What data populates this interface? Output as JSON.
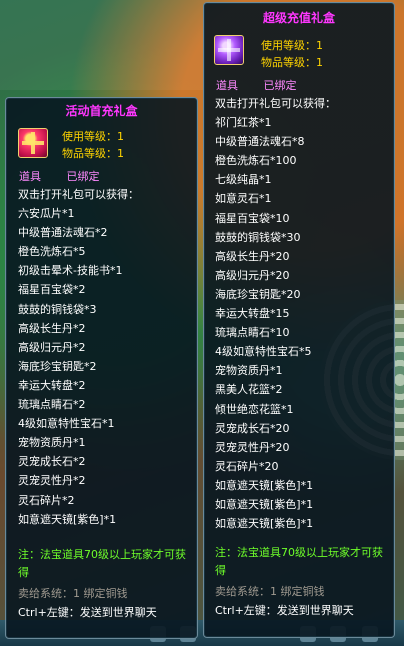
{
  "colors": {
    "title": "#ff37ff",
    "meta": "#ffd400",
    "tag": "#ff8aff",
    "note": "#6fff2a",
    "system": "#a09a90",
    "text": "#ffffff"
  },
  "tooltip_left": {
    "title": "活动首充礼盒",
    "icon": "red-gift-box-icon",
    "use_level": "使用等级：1",
    "item_level": "物品等级：1",
    "tag_type": "道具",
    "tag_bind": "已绑定",
    "desc": "双击打开礼包可以获得：",
    "items": [
      "六安瓜片*1",
      "中级普通法魂石*2",
      "橙色洗炼石*5",
      "初级击晕术-技能书*1",
      "福星百宝袋*2",
      "鼓鼓的铜钱袋*3",
      "高级长生丹*2",
      "高级归元丹*2",
      "海底珍宝钥匙*2",
      "幸运大转盘*2",
      "琉璃点睛石*2",
      "4级如意特性宝石*1",
      "宠物资质丹*1",
      "灵宠成长石*2",
      "灵宠灵性丹*2",
      "灵石碎片*2",
      "如意遮天镜[紫色]*1"
    ],
    "note": "注：法宝道具70级以上玩家才可获得",
    "system": "卖给系统：1 绑定铜钱",
    "ctrl": "Ctrl+左键：发送到世界聊天"
  },
  "tooltip_right": {
    "title": "超级充值礼盒",
    "icon": "purple-gift-box-icon",
    "use_level": "使用等级：1",
    "item_level": "物品等级：1",
    "tag_type": "道具",
    "tag_bind": "已绑定",
    "desc": "双击打开礼包可以获得：",
    "items": [
      "祁门红茶*1",
      "中级普通法魂石*8",
      "橙色洗炼石*100",
      "七级纯晶*1",
      "如意灵石*1",
      "福星百宝袋*10",
      "鼓鼓的铜钱袋*30",
      "高级长生丹*20",
      "高级归元丹*20",
      "海底珍宝钥匙*20",
      "幸运大转盘*15",
      "琉璃点睛石*10",
      "4级如意特性宝石*5",
      "宠物资质丹*1",
      "黑美人花篮*2",
      "倾世绝恋花篮*1",
      "灵宠成长石*20",
      "灵宠灵性丹*20",
      "灵石碎片*20",
      "如意遮天镜[紫色]*1",
      "如意遮天镜[紫色]*1",
      "如意遮天镜[紫色]*1"
    ],
    "note": "注：法宝道具70级以上玩家才可获得",
    "system": "卖给系统：1 绑定铜钱",
    "ctrl": "Ctrl+左键：发送到世界聊天"
  }
}
